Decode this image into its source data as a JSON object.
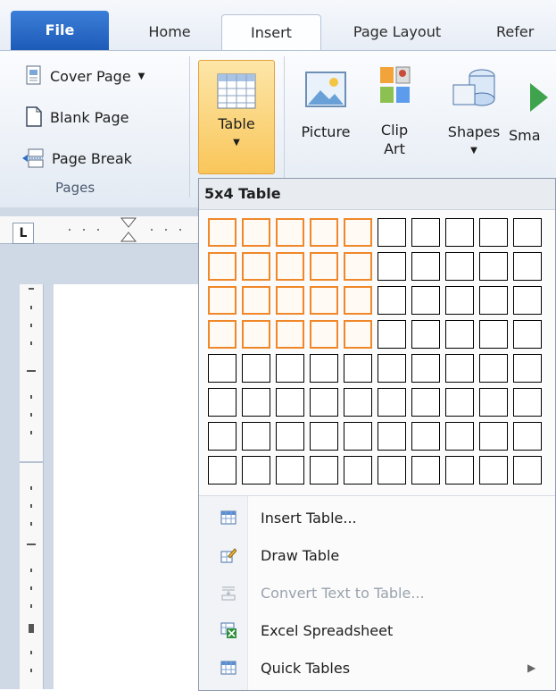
{
  "tabs": [
    {
      "label": "File"
    },
    {
      "label": "Home"
    },
    {
      "label": "Insert"
    },
    {
      "label": "Page Layout"
    },
    {
      "label": "Refer"
    }
  ],
  "pages_group": {
    "label": "Pages",
    "items": [
      {
        "label": "Cover Page",
        "icon": "cover-page-icon",
        "has_dropdown": true
      },
      {
        "label": "Blank Page",
        "icon": "blank-page-icon"
      },
      {
        "label": "Page Break",
        "icon": "page-break-icon"
      }
    ]
  },
  "ribbon_buttons": [
    {
      "line1": "Table",
      "line2": "",
      "icon": "table-icon",
      "has_dropdown": true,
      "arrow": "▼"
    },
    {
      "line1": "Picture",
      "line2": "",
      "icon": "picture-icon"
    },
    {
      "line1": "Clip",
      "line2": "Art",
      "icon": "clip-art-icon"
    },
    {
      "line1": "Shapes",
      "line2": "",
      "icon": "shapes-icon",
      "has_dropdown": true,
      "arrow": "▼"
    },
    {
      "line1": "Sma",
      "line2": "",
      "icon": "smartart-icon"
    }
  ],
  "table_dropdown": {
    "header": "5x4 Table",
    "grid": {
      "columns": 10,
      "rows": 8,
      "selected_columns": 5,
      "selected_rows": 4
    },
    "menu_items": [
      {
        "label": "Insert Table...",
        "icon": "insert-table-icon",
        "enabled": true
      },
      {
        "label": "Draw Table",
        "icon": "draw-table-icon",
        "enabled": true
      },
      {
        "label": "Convert Text to Table...",
        "icon": "convert-text-icon",
        "enabled": false
      },
      {
        "label": "Excel Spreadsheet",
        "icon": "excel-spreadsheet-icon",
        "enabled": true
      },
      {
        "label": "Quick Tables",
        "icon": "quick-tables-icon",
        "enabled": true,
        "submenu": true
      }
    ]
  },
  "ruler": {
    "tab_selector": "L"
  },
  "colors": {
    "file_tab": "#2a6cc8",
    "table_highlight": "#f9c65a",
    "grid_selected_border": "#f0882a"
  }
}
